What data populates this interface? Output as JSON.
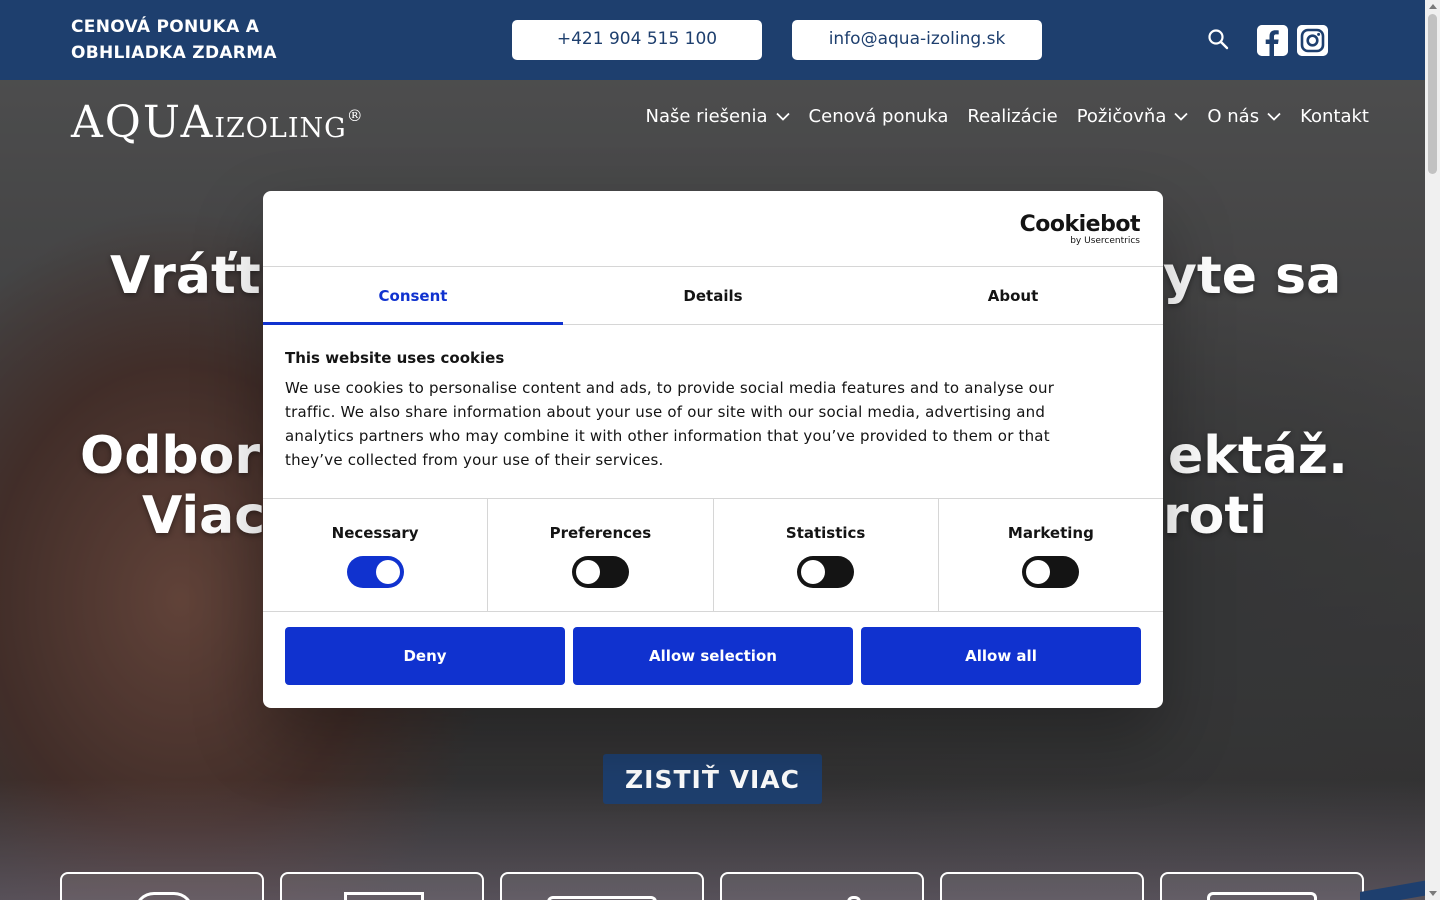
{
  "topbar": {
    "promo": "CENOVÁ PONUKA A OBHLIADKA ZDARMA",
    "phone": "+421 904 515 100",
    "email": "info@aqua-izoling.sk",
    "icons": [
      "search-icon",
      "facebook-icon",
      "instagram-icon"
    ]
  },
  "logo": {
    "big": "AQUA",
    "small": "IZOLING",
    "mark": "®"
  },
  "nav": {
    "items": [
      {
        "label": "Naše riešenia",
        "has_dropdown": true
      },
      {
        "label": "Cenová ponuka",
        "has_dropdown": false
      },
      {
        "label": "Realizácie",
        "has_dropdown": false
      },
      {
        "label": "Požičovňa",
        "has_dropdown": true
      },
      {
        "label": "O nás",
        "has_dropdown": true
      },
      {
        "label": "Kontakt",
        "has_dropdown": false
      }
    ]
  },
  "hero": {
    "line1_left": "Vráťt",
    "line1_right": "yte sa",
    "line2_left": "Odborn",
    "line2_right": "ektáž.",
    "line3_left": "Viac",
    "line3_right": "roti",
    "cta": "ZISTIŤ VIAC"
  },
  "cookie": {
    "brand": "Cookiebot",
    "brand_sub": "by Usercentrics",
    "tabs": [
      {
        "label": "Consent",
        "active": true
      },
      {
        "label": "Details",
        "active": false
      },
      {
        "label": "About",
        "active": false
      }
    ],
    "title": "This website uses cookies",
    "text": "We use cookies to personalise content and ads, to provide social media features and to analyse our traffic. We also share information about your use of our site with our social media, advertising and analytics partners who may combine it with other information that you’ve provided to them or that they’ve collected from your use of their services.",
    "toggles": [
      {
        "label": "Necessary",
        "on": true
      },
      {
        "label": "Preferences",
        "on": false
      },
      {
        "label": "Statistics",
        "on": false
      },
      {
        "label": "Marketing",
        "on": false
      }
    ],
    "buttons": {
      "deny": "Deny",
      "selection": "Allow selection",
      "all": "Allow all"
    }
  },
  "colors": {
    "brand_navy": "#1e3f6e",
    "cookie_blue": "#1032cf"
  }
}
